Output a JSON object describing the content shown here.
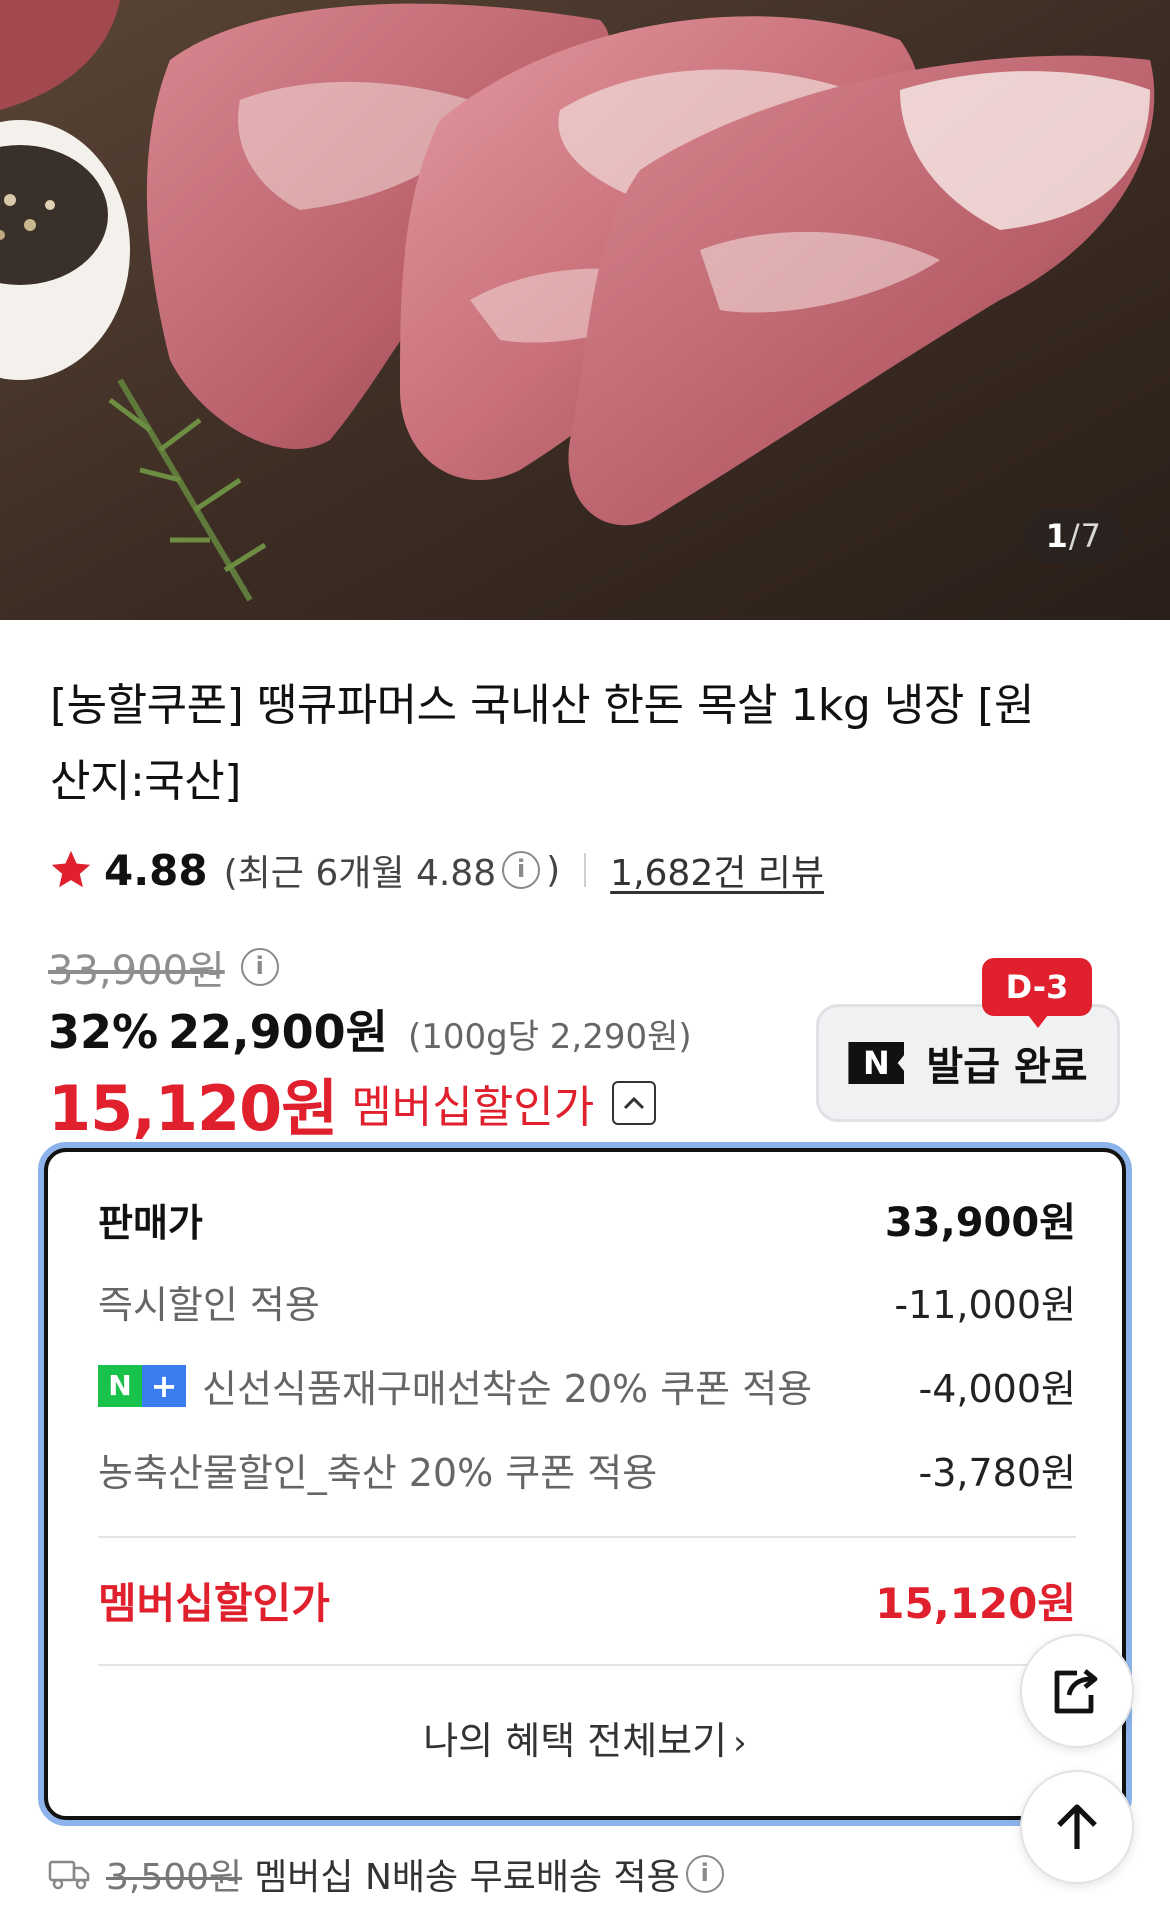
{
  "gallery": {
    "current": "1",
    "separator": "/",
    "total": "7"
  },
  "product": {
    "title": "[농할쿠폰] 땡큐파머스 국내산 한돈 목살 1kg 냉장 [원산지:국산]"
  },
  "rating": {
    "score": "4.88",
    "recent": "(최근 6개월 4.88",
    "recent_close": ")",
    "review_count": "1,682건 리뷰"
  },
  "price": {
    "original": "33,900원",
    "discount_rate": "32%",
    "sale": "22,900원",
    "unit": "(100g당 2,290원)",
    "member_price": "15,120원",
    "member_label": "멤버십할인가"
  },
  "coupon": {
    "badge": "D-3",
    "logo": "N",
    "label": "발급 완료"
  },
  "benefits": {
    "rows": [
      {
        "label": "판매가",
        "value": "33,900원"
      },
      {
        "label": "즉시할인 적용",
        "value": "-11,000원"
      },
      {
        "badge_n": "N",
        "badge_plus": "+",
        "label": "신선식품재구매선착순 20% 쿠폰 적용",
        "value": "-4,000원"
      },
      {
        "label": "농축산물할인_축산 20% 쿠폰 적용",
        "value": "-3,780원"
      }
    ],
    "total_label": "멤버십할인가",
    "total_value": "15,120원",
    "view_all": "나의 혜택 전체보기",
    "view_all_chevron": "›"
  },
  "shipping": {
    "original_fee": "3,500원",
    "text": "멤버십 N배송 무료배송 적용"
  },
  "colors": {
    "accent_red": "#e0202d",
    "panel_highlight": "#8db4ea",
    "naver_green": "#19c24b",
    "naver_blue": "#3a7df0"
  },
  "icons": {
    "star": "star-icon",
    "info": "info-icon",
    "toggle": "chevron-up-icon",
    "share": "share-icon",
    "top": "arrow-up-icon",
    "truck": "truck-icon"
  }
}
